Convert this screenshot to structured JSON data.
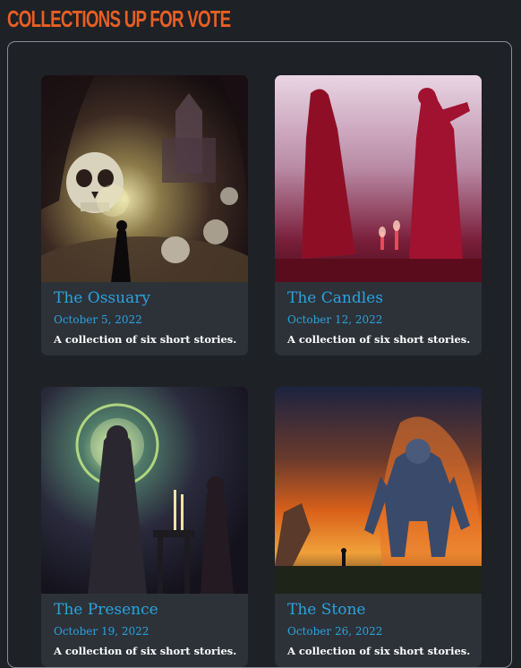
{
  "page": {
    "title": "COLLECTIONS UP FOR VOTE"
  },
  "collections": [
    {
      "title": "The Ossuary",
      "date": "October 5, 2022",
      "description": "A collection of six short stories.",
      "image": "skull-crypt-artwork"
    },
    {
      "title": "The Candles",
      "date": "October 12, 2022",
      "description": "A collection of six short stories.",
      "image": "red-robed-figures-artwork"
    },
    {
      "title": "The Presence",
      "date": "October 19, 2022",
      "description": "A collection of six short stories.",
      "image": "hooded-figures-altar-artwork"
    },
    {
      "title": "The Stone",
      "date": "October 26, 2022",
      "description": "A collection of six short stories.",
      "image": "stone-golem-fire-artwork"
    }
  ],
  "colors": {
    "accent": "#e85f23",
    "link": "#2aa3e0",
    "background": "#1e2126",
    "card": "#2d3238"
  }
}
